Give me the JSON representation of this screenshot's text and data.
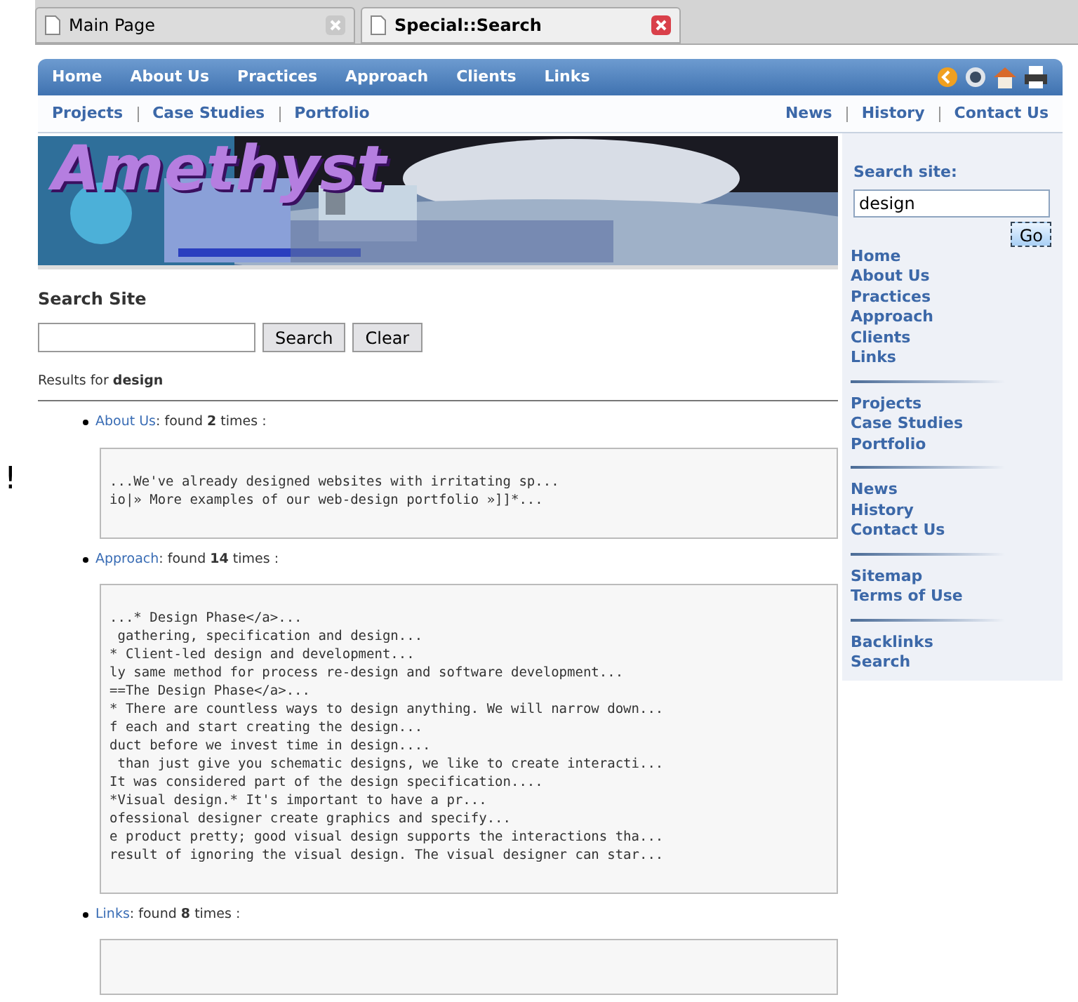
{
  "browser_tabs": [
    {
      "title": "Main Page",
      "selected": false
    },
    {
      "title": "Special::Search",
      "selected": true
    }
  ],
  "nav": {
    "primary": [
      "Home",
      "About Us",
      "Practices",
      "Approach",
      "Clients",
      "Links"
    ],
    "secondary_left": [
      "Projects",
      "Case Studies",
      "Portfolio"
    ],
    "secondary_right": [
      "News",
      "History",
      "Contact Us"
    ]
  },
  "banner": {
    "logo": "Amethyst"
  },
  "stray_mark": "!",
  "search": {
    "heading": "Search Site",
    "button": "Search",
    "clear_button": "Clear",
    "results_label": "Results for",
    "query": "design"
  },
  "results": [
    {
      "page": "About Us",
      "colon": ":",
      "found": "found",
      "count": "2",
      "times": "times :",
      "snippet": [
        "...We've already designed websites with irritating sp...",
        "io|» More examples of our web-design portfolio »]]*..."
      ]
    },
    {
      "page": "Approach",
      "colon": ":",
      "found": "found",
      "count": "14",
      "times": "times :",
      "snippet": [
        "...* Design Phase</a>...",
        " gathering, specification and design...",
        "* Client-led design and development...",
        "ly same method for process re-design and software development...",
        "==The Design Phase</a>...",
        "* There are countless ways to design anything. We will narrow down...",
        "f each and start creating the design...",
        "duct before we invest time in design....",
        " than just give you schematic designs, we like to create interacti...",
        "It was considered part of the design specification....",
        "*Visual design.* It's important to have a pr...",
        "ofessional designer create graphics and specify...",
        "e product pretty; good visual design supports the interactions tha...",
        "result of ignoring the visual design. The visual designer can star..."
      ]
    },
    {
      "page": "Links",
      "colon": ":",
      "found": "found",
      "count": "8",
      "times": "times :"
    }
  ],
  "sidebar": {
    "search_label": "Search site:",
    "search_value": "design",
    "go_button": "Go",
    "groups": [
      [
        "Home",
        "About Us",
        "Practices",
        "Approach",
        "Clients",
        "Links"
      ],
      [
        "Projects",
        "Case Studies",
        "Portfolio"
      ],
      [
        "News",
        "History",
        "Contact Us"
      ],
      [
        "Sitemap",
        "Terms of Use"
      ],
      [
        "Backlinks",
        "Search"
      ]
    ]
  }
}
